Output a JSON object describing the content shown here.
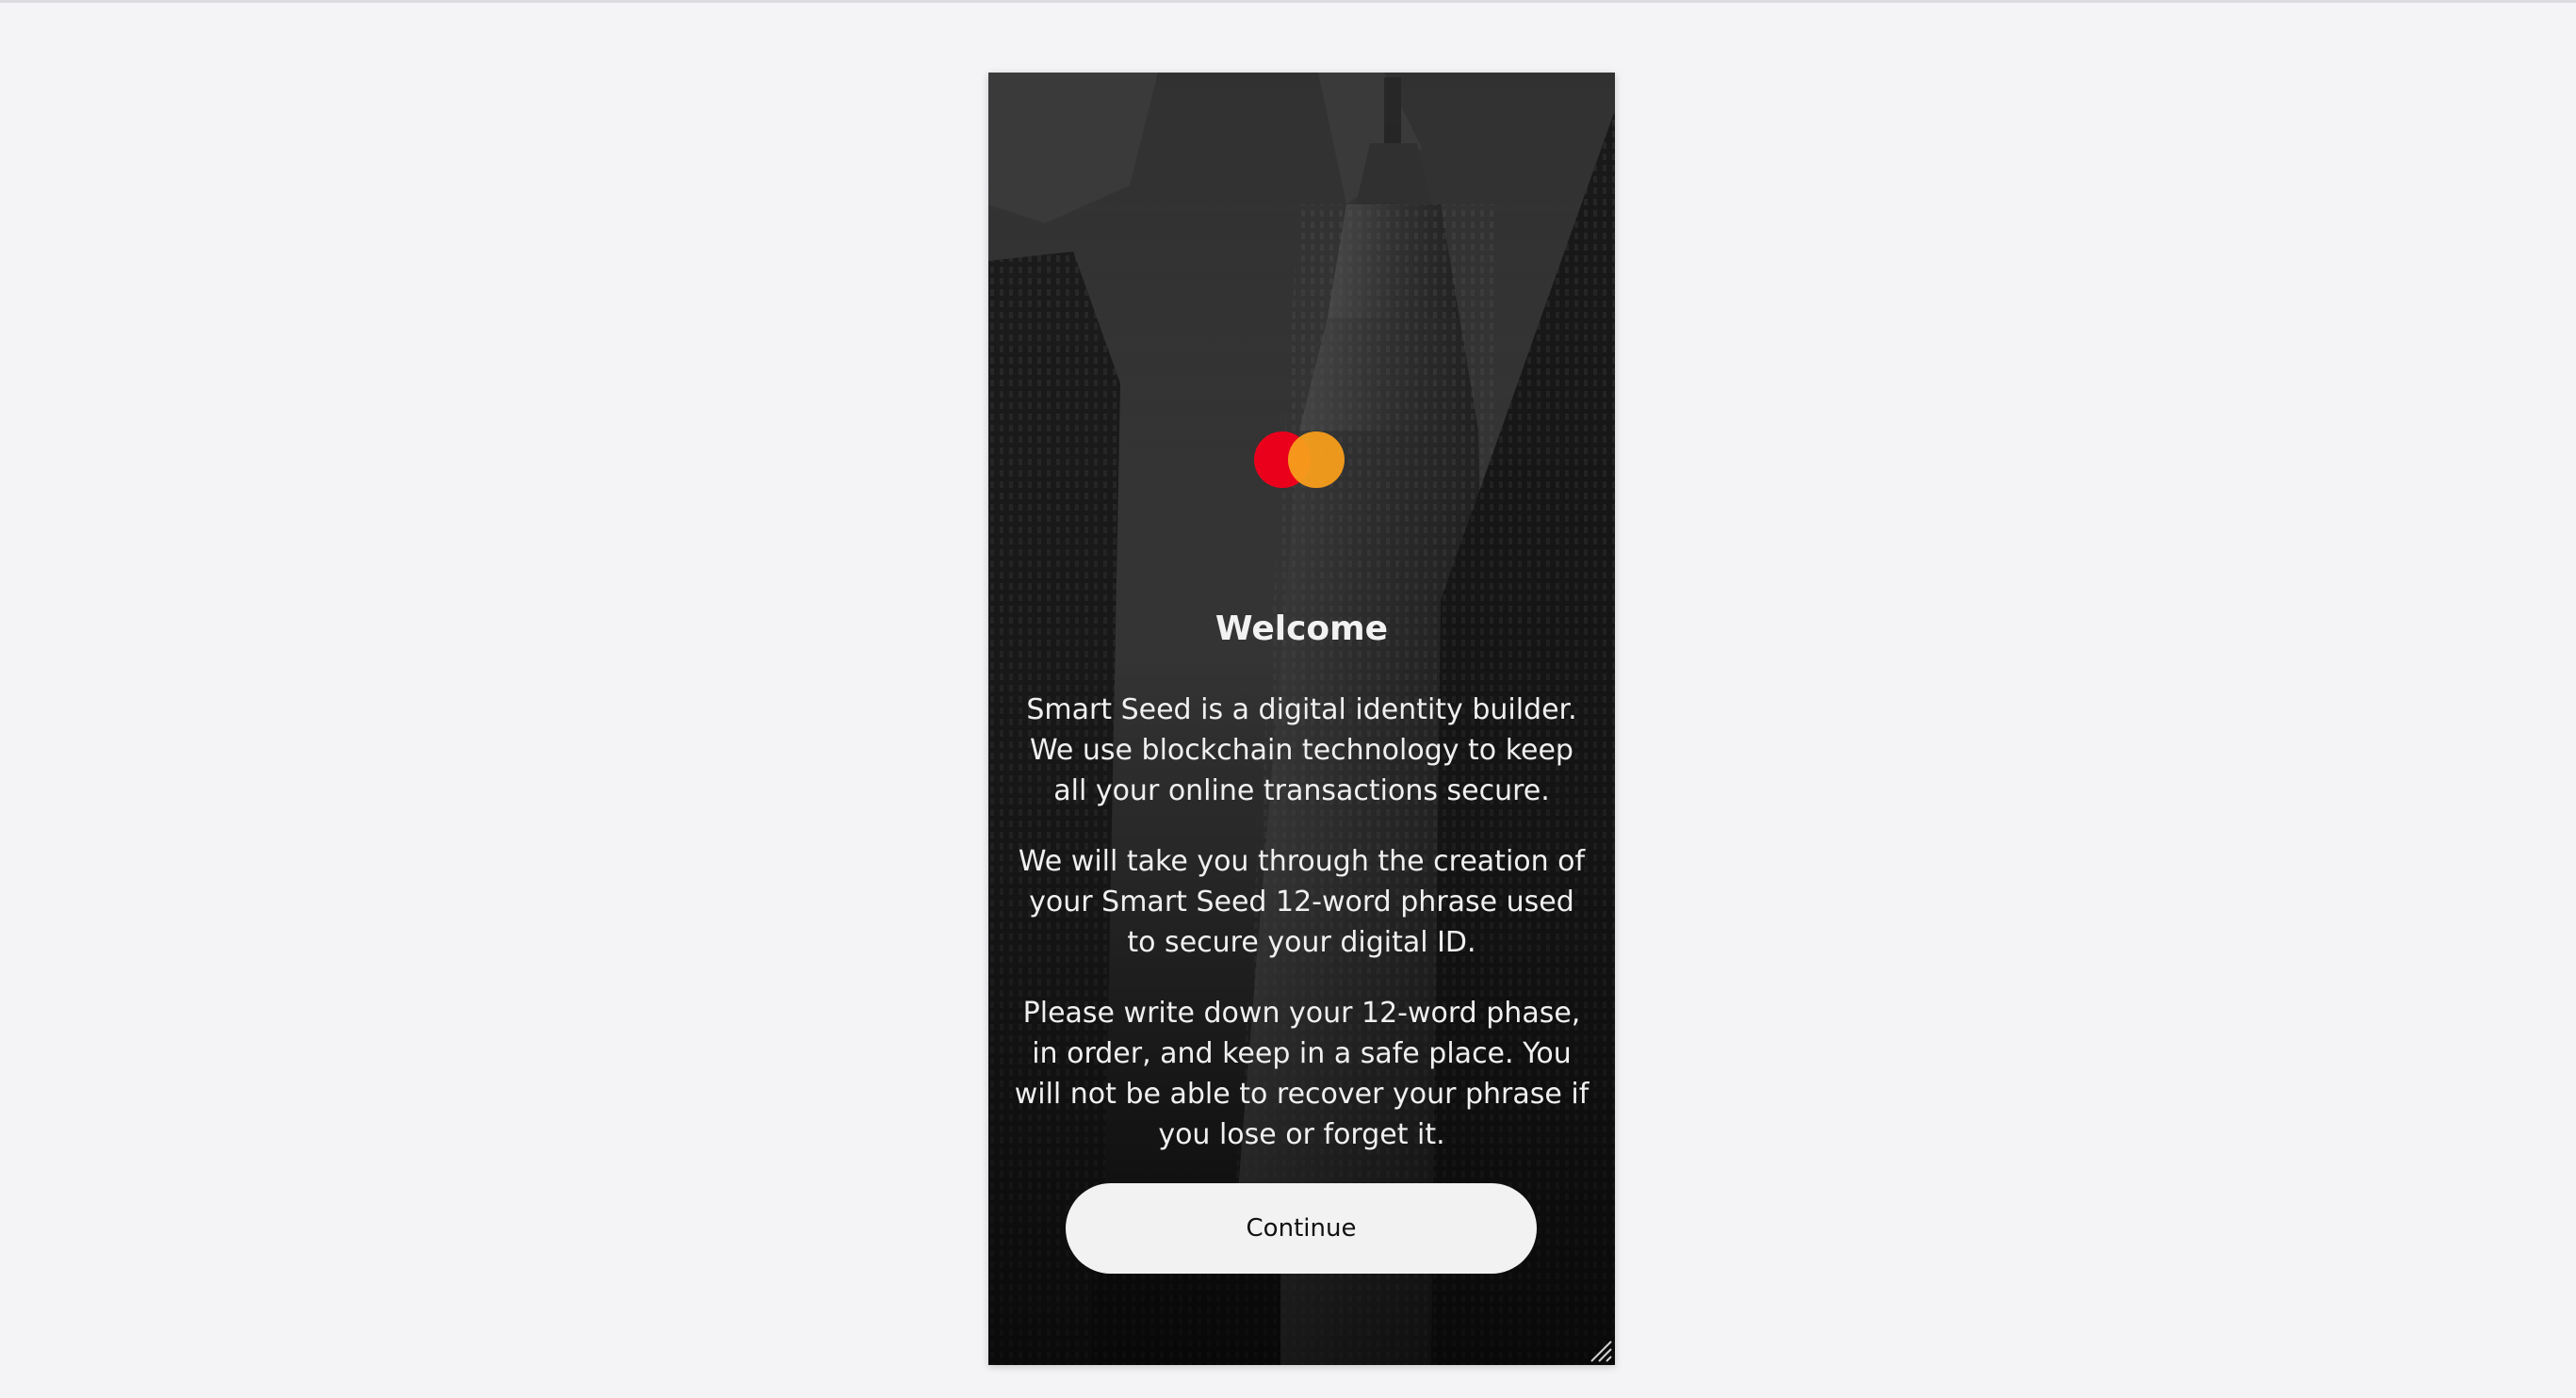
{
  "welcome": {
    "title": "Welcome",
    "paragraph_1": "Smart Seed is a digital identity builder. We use blockchain technology to keep all your online transactions secure.",
    "paragraph_2": "We will take you through the creation of your Smart Seed 12-word phrase used to secure your digital ID.",
    "paragraph_3": "Please write down your 12-word phase, in order, and keep in a safe place. You will not be able to recover your phrase if you lose or forget it.",
    "continue_label": "Continue"
  },
  "brand": {
    "logo_icon": "mastercard-logo-icon",
    "red": "#eb001b",
    "orange": "#f79e1b"
  },
  "background": {
    "icon": "skyscraper-photo",
    "tone": "grayscale"
  }
}
